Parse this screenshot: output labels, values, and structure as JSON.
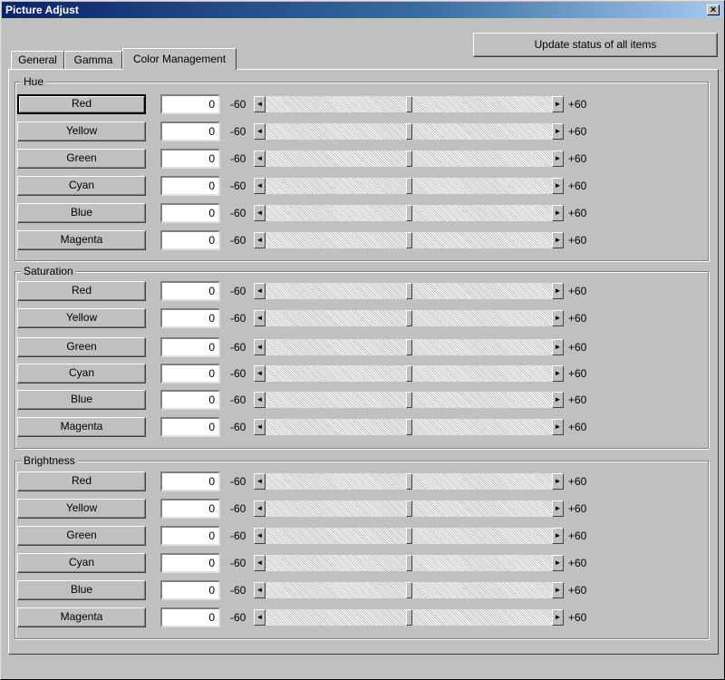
{
  "window": {
    "title": "Picture Adjust",
    "close_label": "×"
  },
  "update_button": {
    "label": "Update status of all items"
  },
  "tabs": [
    {
      "label": "General"
    },
    {
      "label": "Gamma"
    },
    {
      "label": "Color Management"
    }
  ],
  "groups": [
    {
      "legend": "Hue",
      "items": [
        {
          "label": "Red",
          "value": "0"
        },
        {
          "label": "Yellow",
          "value": "0"
        },
        {
          "label": "Green",
          "value": "0"
        },
        {
          "label": "Cyan",
          "value": "0"
        },
        {
          "label": "Blue",
          "value": "0"
        },
        {
          "label": "Magenta",
          "value": "0"
        }
      ]
    },
    {
      "legend": "Saturation",
      "items": [
        {
          "label": "Red",
          "value": "0"
        },
        {
          "label": "Yellow",
          "value": "0"
        },
        {
          "label": "Green",
          "value": "0"
        },
        {
          "label": "Cyan",
          "value": "0"
        },
        {
          "label": "Blue",
          "value": "0"
        },
        {
          "label": "Magenta",
          "value": "0"
        }
      ]
    },
    {
      "legend": "Brightness",
      "items": [
        {
          "label": "Red",
          "value": "0"
        },
        {
          "label": "Yellow",
          "value": "0"
        },
        {
          "label": "Green",
          "value": "0"
        },
        {
          "label": "Cyan",
          "value": "0"
        },
        {
          "label": "Blue",
          "value": "0"
        },
        {
          "label": "Magenta",
          "value": "0"
        }
      ]
    }
  ],
  "slider": {
    "min_label": "-60",
    "max_label": "+60",
    "min": -60,
    "max": 60
  },
  "icons": {
    "left_arrow": "◄",
    "right_arrow": "►"
  }
}
